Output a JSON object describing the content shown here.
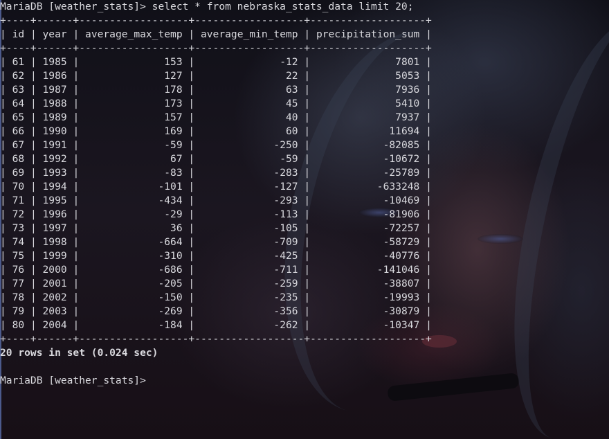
{
  "terminal": {
    "prompt": "MariaDB [weather_stats]>",
    "command": "select * from nebraska_stats_data limit 20;",
    "table": {
      "columns": [
        "id",
        "year",
        "average_max_temp",
        "average_min_temp",
        "precipitation_sum"
      ],
      "rows": [
        [
          "61",
          "1985",
          "153",
          "-12",
          "7801"
        ],
        [
          "62",
          "1986",
          "127",
          "22",
          "5053"
        ],
        [
          "63",
          "1987",
          "178",
          "63",
          "7936"
        ],
        [
          "64",
          "1988",
          "173",
          "45",
          "5410"
        ],
        [
          "65",
          "1989",
          "157",
          "40",
          "7937"
        ],
        [
          "66",
          "1990",
          "169",
          "60",
          "11694"
        ],
        [
          "67",
          "1991",
          "-59",
          "-250",
          "-82085"
        ],
        [
          "68",
          "1992",
          "67",
          "-59",
          "-10672"
        ],
        [
          "69",
          "1993",
          "-83",
          "-283",
          "-25789"
        ],
        [
          "70",
          "1994",
          "-101",
          "-127",
          "-633248"
        ],
        [
          "71",
          "1995",
          "-434",
          "-293",
          "-10469"
        ],
        [
          "72",
          "1996",
          "-29",
          "-113",
          "-81906"
        ],
        [
          "73",
          "1997",
          "36",
          "-105",
          "-72257"
        ],
        [
          "74",
          "1998",
          "-664",
          "-709",
          "-58729"
        ],
        [
          "75",
          "1999",
          "-310",
          "-425",
          "-40776"
        ],
        [
          "76",
          "2000",
          "-686",
          "-711",
          "-141046"
        ],
        [
          "77",
          "2001",
          "-205",
          "-259",
          "-38807"
        ],
        [
          "78",
          "2002",
          "-150",
          "-235",
          "-19993"
        ],
        [
          "79",
          "2003",
          "-269",
          "-356",
          "-30879"
        ],
        [
          "80",
          "2004",
          "-184",
          "-262",
          "-10347"
        ]
      ]
    },
    "status": "20 rows in set (0.024 sec)",
    "final_prompt": "MariaDB [weather_stats]>"
  }
}
